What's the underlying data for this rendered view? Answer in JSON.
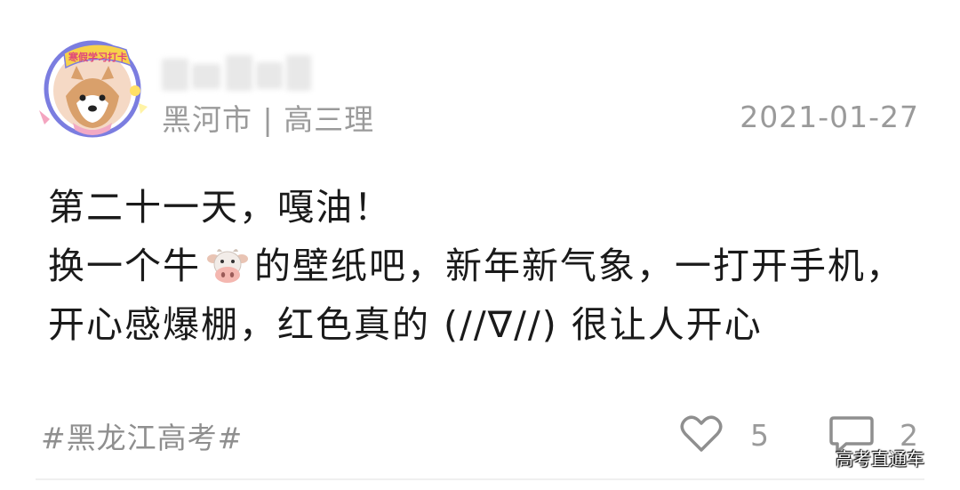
{
  "post": {
    "avatar_badge_text": "寒假学习打卡",
    "location_grade": "黑河市 | 高三理",
    "date": "2021-01-27",
    "content_line1": "第二十一天，嘎油！",
    "content_line2_before": "换一个牛",
    "content_line2_after": "的壁纸吧，新年新气象，一打开手机，开心感爆棚，红色真的 (//∇//) 很让人开心",
    "hashtag": "#黑龙江高考#",
    "like_count": "5",
    "comment_count": "2"
  },
  "watermark": "高考直通车",
  "colors": {
    "meta_gray": "#9a9a9a",
    "text": "#1a1a1a",
    "avatar_ring": "#7b7de0"
  },
  "icons": {
    "cow": "cow-face-emoji",
    "like": "heart-outline-icon",
    "comment": "comment-bubble-icon"
  }
}
